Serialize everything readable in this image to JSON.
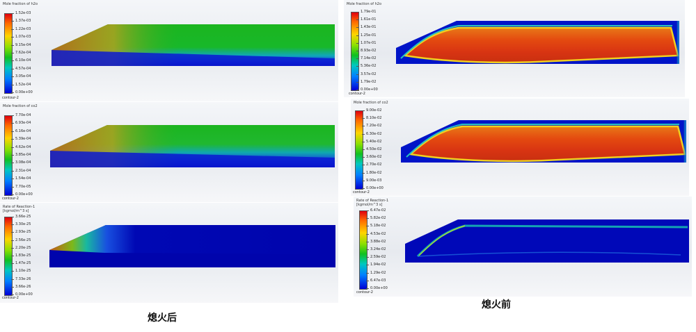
{
  "captions": {
    "after": "熄火后",
    "before": "熄火前"
  },
  "panels": [
    {
      "title": "Mole fraction of h2o",
      "ticks": [
        "1.52e-03",
        "1.37e-03",
        "1.22e-03",
        "1.07e-03",
        "9.15e-04",
        "7.62e-04",
        "6.10e-04",
        "4.57e-04",
        "3.05e-04",
        "1.52e-04",
        "0.00e+00"
      ],
      "contour": "contour-2"
    },
    {
      "title": "Mole fraction of co2",
      "ticks": [
        "7.70e-04",
        "6.93e-04",
        "6.16e-04",
        "5.39e-04",
        "4.62e-04",
        "3.85e-04",
        "3.08e-04",
        "2.31e-04",
        "1.54e-04",
        "7.70e-05",
        "0.00e+00"
      ],
      "contour": "contour-2"
    },
    {
      "title": "Rate of Reaction-1\n[kgmol/m^3 s]",
      "ticks": [
        "3.66e-25",
        "3.30e-25",
        "2.93e-25",
        "2.56e-25",
        "2.20e-25",
        "1.83e-25",
        "1.47e-25",
        "1.10e-25",
        "7.33e-26",
        "3.66e-26",
        "0.00e+00"
      ],
      "contour": "contour-2"
    },
    {
      "title": "Mole fraction of h2o",
      "ticks": [
        "1.79e-01",
        "1.61e-01",
        "1.43e-01",
        "1.25e-01",
        "1.07e-01",
        "8.93e-02",
        "7.14e-02",
        "5.36e-02",
        "3.57e-02",
        "1.79e-02",
        "0.00e+00"
      ],
      "contour": "contour-2"
    },
    {
      "title": "Mole fraction of co2",
      "ticks": [
        "9.00e-02",
        "8.10e-02",
        "7.20e-02",
        "6.30e-02",
        "5.40e-02",
        "4.50e-02",
        "3.60e-02",
        "2.70e-02",
        "1.80e-02",
        "9.00e-03",
        "0.00e+00"
      ],
      "contour": "contour-2"
    },
    {
      "title": "Rate of Reaction-1\n[kgmol/m^3 s]",
      "ticks": [
        "6.47e-02",
        "5.82e-02",
        "5.18e-02",
        "4.53e-02",
        "3.88e-02",
        "3.24e-02",
        "2.59e-02",
        "1.94e-02",
        "1.29e-02",
        "6.47e-03",
        "0.00e+00"
      ],
      "contour": "contour-2"
    }
  ]
}
